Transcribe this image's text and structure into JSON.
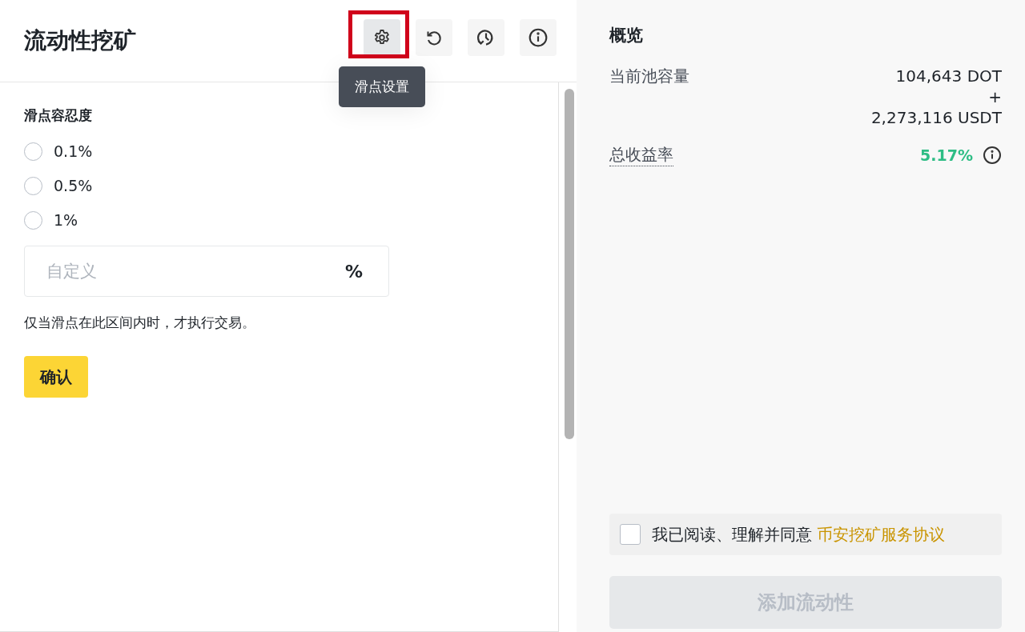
{
  "header": {
    "title": "流动性挖矿"
  },
  "toolbar": [
    {
      "kind": "gear",
      "selected": true,
      "highlighted": true,
      "tooltip": "滑点设置"
    },
    {
      "kind": "undo",
      "selected": false,
      "highlighted": false
    },
    {
      "kind": "history",
      "selected": false,
      "highlighted": false
    },
    {
      "kind": "info",
      "selected": false,
      "highlighted": false
    }
  ],
  "slippage": {
    "title": "滑点容忍度",
    "options": [
      {
        "label": "0.1%",
        "selected": false
      },
      {
        "label": "0.5%",
        "selected": false
      },
      {
        "label": "1%",
        "selected": false
      }
    ],
    "custom": {
      "placeholder": "自定义",
      "unit": "%"
    },
    "note": "仅当滑点在此区间内时，才执行交易。",
    "confirm": "确认"
  },
  "overview": {
    "title": "概览",
    "pool_label": "当前池容量",
    "pool_values": [
      "104,643 DOT",
      "+",
      "2,273,116 USDT"
    ],
    "apr_label": "总收益率",
    "apr_value": "5.17%"
  },
  "agreement": {
    "checked": false,
    "text": "我已阅读、理解并同意",
    "link": "币安挖矿服务协议"
  },
  "add_button": {
    "label": "添加流动性",
    "disabled": true
  }
}
